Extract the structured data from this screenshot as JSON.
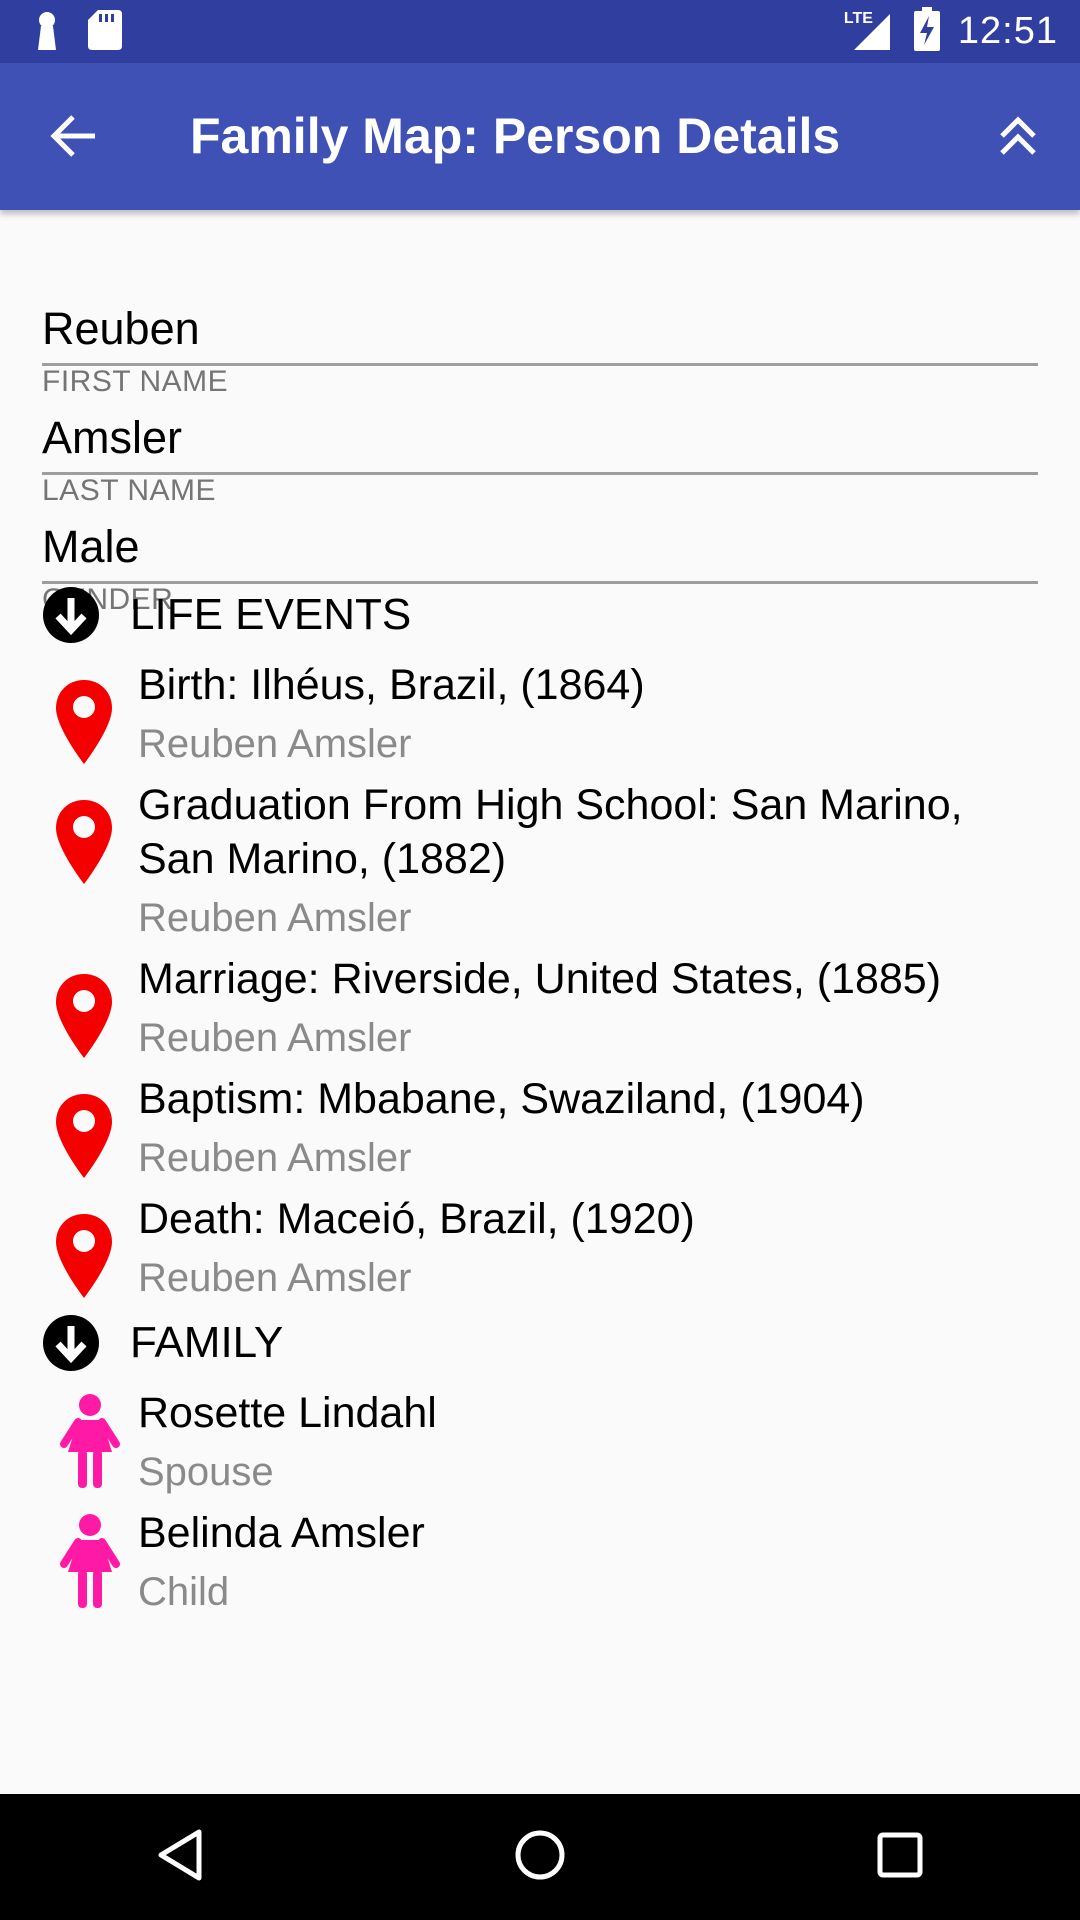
{
  "status_bar": {
    "network": "LTE",
    "time": "12:51",
    "icons": [
      "keyhole-icon",
      "sd-card-icon",
      "signal-icon",
      "battery-charging-icon"
    ]
  },
  "app_bar": {
    "title": "Family Map: Person Details",
    "back_icon": "arrow-left-icon",
    "top_icon": "double-chevron-up-icon"
  },
  "person": {
    "first_name": {
      "value": "Reuben",
      "label": "FIRST NAME"
    },
    "last_name": {
      "value": "Amsler",
      "label": "LAST NAME"
    },
    "gender": {
      "value": "Male",
      "label": "GENDER"
    }
  },
  "life_events": {
    "header": "LIFE EVENTS",
    "marker_color": "#f40000",
    "items": [
      {
        "title": "Birth: Ilhéus, Brazil, (1864)",
        "person": "Reuben Amsler"
      },
      {
        "title": "Graduation From High School: San Marino, San Marino, (1882)",
        "person": "Reuben Amsler"
      },
      {
        "title": "Marriage: Riverside, United States, (1885)",
        "person": "Reuben Amsler"
      },
      {
        "title": "Baptism: Mbabane, Swaziland, (1904)",
        "person": "Reuben Amsler"
      },
      {
        "title": "Death: Maceió, Brazil, (1920)",
        "person": "Reuben Amsler"
      }
    ]
  },
  "family": {
    "header": "FAMILY",
    "icon_color": "#ff1aa6",
    "items": [
      {
        "name": "Rosette Lindahl",
        "relation": "Spouse",
        "icon": "female-icon"
      },
      {
        "name": "Belinda Amsler",
        "relation": "Child",
        "icon": "female-icon"
      }
    ]
  },
  "nav_bar": {
    "icons": [
      "back-triangle-icon",
      "home-circle-icon",
      "recents-square-icon"
    ]
  }
}
